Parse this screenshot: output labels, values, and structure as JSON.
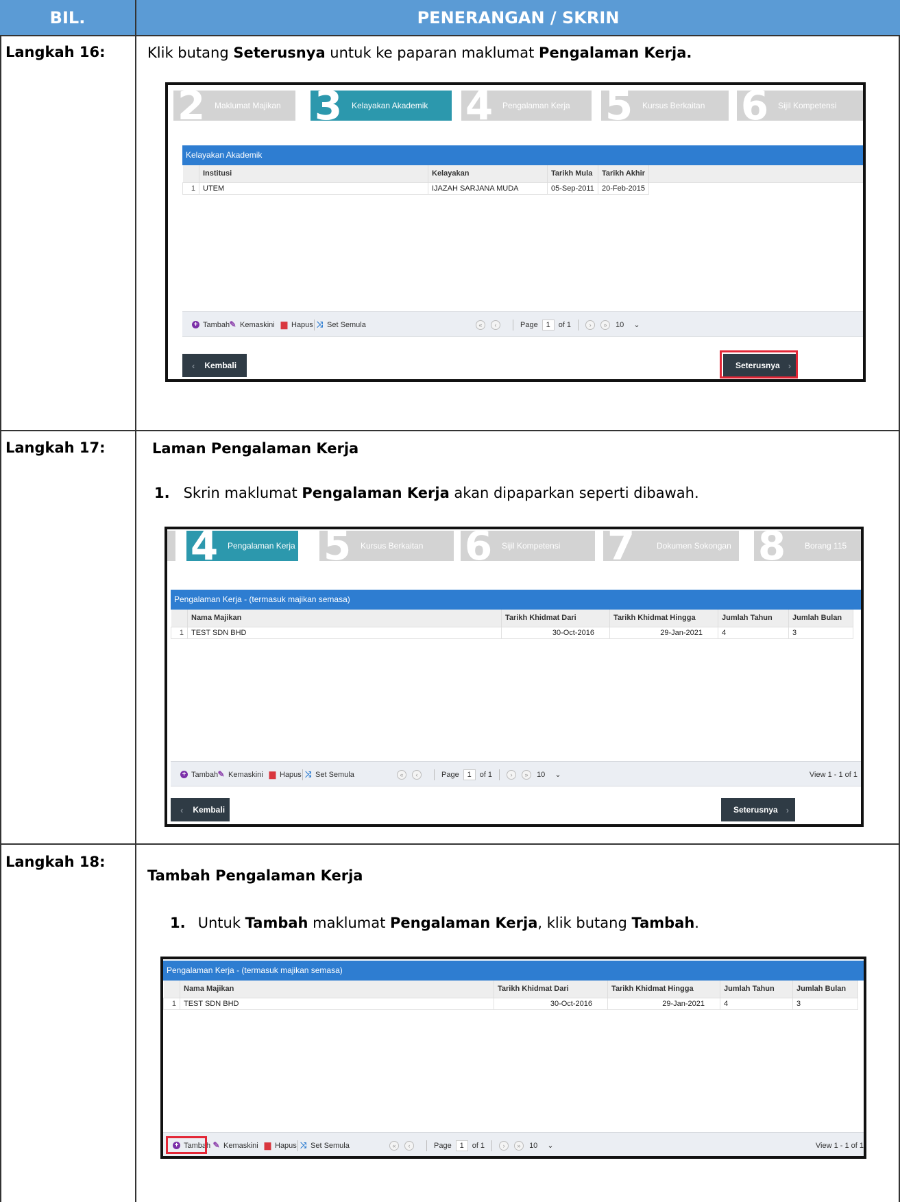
{
  "header": {
    "bil": "BIL.",
    "penerangan": "PENERANGAN / SKRIN"
  },
  "steps": [
    {
      "label": "Langkah 16:",
      "text_1": "Klik butang ",
      "text_2": "Seterusnya",
      "text_3": " untuk ke paparan maklumat ",
      "text_4": "Pengalaman Kerja.",
      "screen": {
        "wizard": [
          {
            "num": "2",
            "label": "Maklumat Majikan"
          },
          {
            "num": "3",
            "label": "Kelayakan Akademik"
          },
          {
            "num": "4",
            "label": "Pengalaman Kerja"
          },
          {
            "num": "5",
            "label": "Kursus Berkaitan"
          },
          {
            "num": "6",
            "label": "Sijil Kompetensi"
          }
        ],
        "grid_title": "Kelayakan Akademik",
        "columns": [
          "Institusi",
          "Kelayakan",
          "Tarikh Mula",
          "Tarikh Akhir"
        ],
        "row": {
          "no": "1",
          "c1": "UTEM",
          "c2": "IJAZAH SARJANA MUDA",
          "c3": "05-Sep-2011",
          "c4": "20-Feb-2015"
        },
        "toolbar": {
          "add": "Tambah",
          "edit": "Kemaskini",
          "delete": "Hapus",
          "reset": "Set Semula",
          "page": "Page",
          "page_value": "1",
          "of": "of 1",
          "rows": "10"
        },
        "back": "Kembali",
        "next": "Seterusnya"
      }
    },
    {
      "label": "Langkah 17:",
      "title": "Laman Pengalaman Kerja",
      "item_no": "1.",
      "text_1": "Skrin maklumat ",
      "text_2": "Pengalaman Kerja",
      "text_3": " akan dipaparkan seperti dibawah.",
      "screen": {
        "wizard": [
          {
            "num": "4",
            "label": "Pengalaman Kerja"
          },
          {
            "num": "5",
            "label": "Kursus Berkaitan"
          },
          {
            "num": "6",
            "label": "Sijil Kompetensi"
          },
          {
            "num": "7",
            "label": "Dokumen Sokongan"
          },
          {
            "num": "8",
            "label": "Borang 115"
          }
        ],
        "grid_title": "Pengalaman Kerja - (termasuk majikan semasa)",
        "columns": [
          "Nama Majikan",
          "Tarikh Khidmat Dari",
          "Tarikh Khidmat Hingga",
          "Jumlah Tahun",
          "Jumlah Bulan"
        ],
        "row": {
          "no": "1",
          "c1": "TEST SDN BHD",
          "c2": "30-Oct-2016",
          "c3": "29-Jan-2021",
          "c4": "4",
          "c5": "3"
        },
        "toolbar": {
          "add": "Tambah",
          "edit": "Kemaskini",
          "delete": "Hapus",
          "reset": "Set Semula",
          "page": "Page",
          "page_value": "1",
          "of": "of 1",
          "rows": "10",
          "view": "View 1 - 1 of 1"
        },
        "back": "Kembali",
        "next": "Seterusnya"
      }
    },
    {
      "label": "Langkah 18:",
      "title": "Tambah Pengalaman Kerja",
      "item_no": "1.",
      "text_1": "Untuk ",
      "text_2": "Tambah",
      "text_3": " maklumat ",
      "text_4": "Pengalaman Kerja",
      "text_5": ", klik butang ",
      "text_6": "Tambah",
      "text_7": ".",
      "screen": {
        "grid_title": "Pengalaman Kerja - (termasuk majikan semasa)",
        "columns": [
          "Nama Majikan",
          "Tarikh Khidmat Dari",
          "Tarikh Khidmat Hingga",
          "Jumlah Tahun",
          "Jumlah Bulan"
        ],
        "row": {
          "no": "1",
          "c1": "TEST SDN BHD",
          "c2": "30-Oct-2016",
          "c3": "29-Jan-2021",
          "c4": "4",
          "c5": "3"
        },
        "toolbar": {
          "add": "Tambah",
          "edit": "Kemaskini",
          "delete": "Hapus",
          "reset": "Set Semula",
          "page": "Page",
          "page_value": "1",
          "of": "of 1",
          "rows": "10",
          "view": "View 1 - 1 of 1"
        }
      }
    }
  ]
}
